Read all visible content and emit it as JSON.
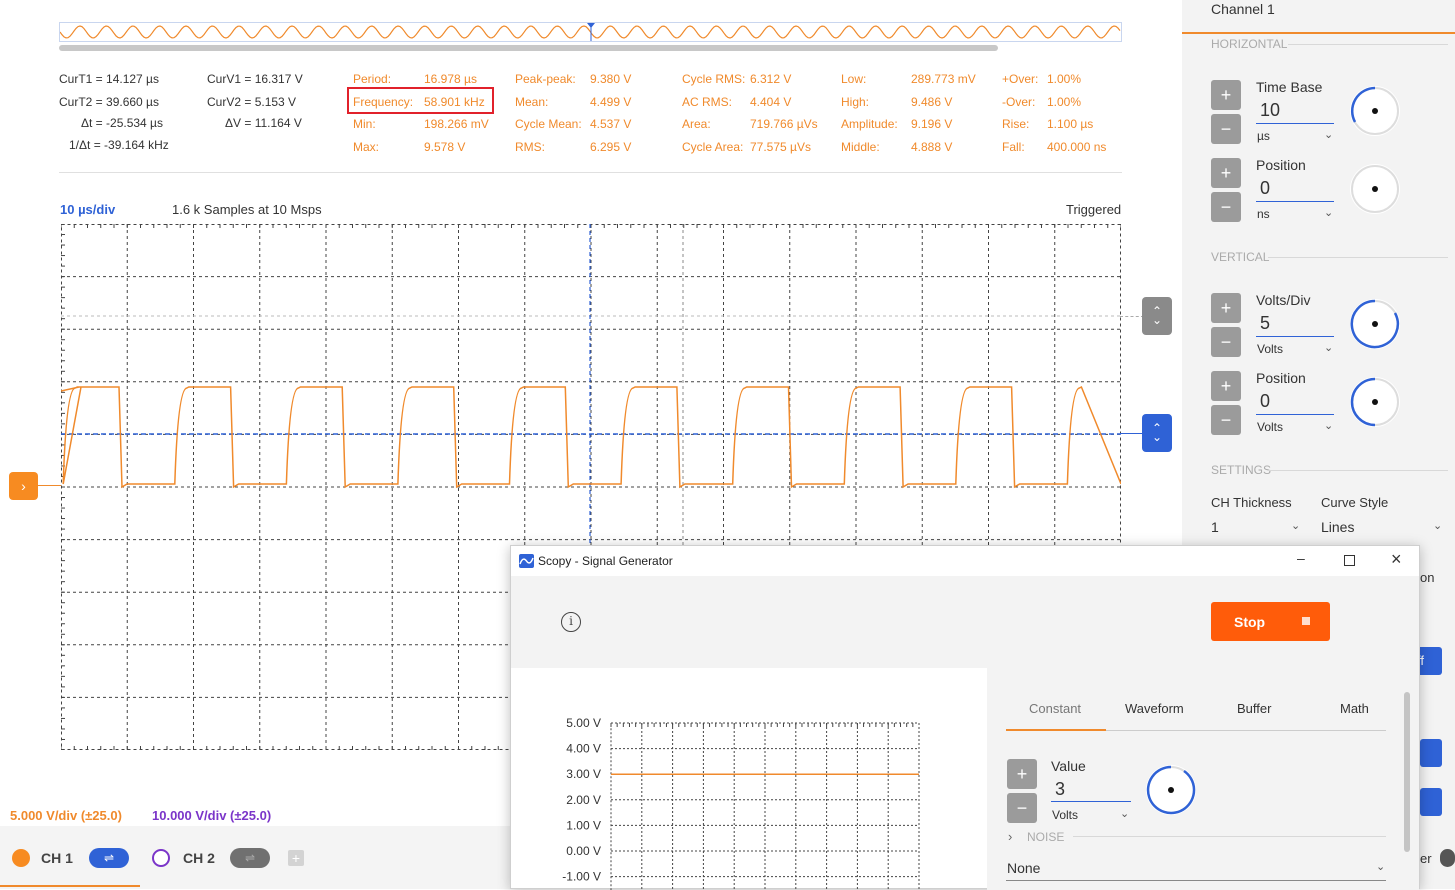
{
  "cursors": {
    "curT1": "CurT1 = 14.127 µs",
    "curT2": "CurT2 = 39.660 µs",
    "deltaT": "Δt = -25.534 µs",
    "invDeltaT": "1/Δt = -39.164 kHz",
    "curV1": "CurV1 = 16.317 V",
    "curV2": "CurV2 = 5.153 V",
    "deltaV": "ΔV = 11.164 V"
  },
  "measurements": [
    {
      "label": "Period:",
      "value": "16.978 µs"
    },
    {
      "label": "Frequency:",
      "value": "58.901 kHz"
    },
    {
      "label": "Min:",
      "value": "198.266 mV"
    },
    {
      "label": "Max:",
      "value": "9.578 V"
    },
    {
      "label": "Peak-peak:",
      "value": "9.380 V"
    },
    {
      "label": "Mean:",
      "value": "4.499 V"
    },
    {
      "label": "Cycle Mean:",
      "value": "4.537 V"
    },
    {
      "label": "RMS:",
      "value": "6.295 V"
    },
    {
      "label": "Cycle RMS:",
      "value": "6.312 V"
    },
    {
      "label": "AC RMS:",
      "value": "4.404 V"
    },
    {
      "label": "Area:",
      "value": "719.766 µVs"
    },
    {
      "label": "Cycle Area:",
      "value": "77.575 µVs"
    },
    {
      "label": "Low:",
      "value": "289.773 mV"
    },
    {
      "label": "High:",
      "value": "9.486 V"
    },
    {
      "label": "Amplitude:",
      "value": "9.196 V"
    },
    {
      "label": "Middle:",
      "value": "4.888 V"
    },
    {
      "label": "+Over:",
      "value": "1.00%"
    },
    {
      "label": "-Over:",
      "value": "1.00%"
    },
    {
      "label": "Rise:",
      "value": "1.100 µs"
    },
    {
      "label": "Fall:",
      "value": "400.000 ns"
    }
  ],
  "plot": {
    "time_div": "10 µs/div",
    "samples": "1.6 k Samples at 10 Msps",
    "status": "Triggered",
    "cycles_in_view": 9.5
  },
  "footer": {
    "ch1_vdiv": "5.000 V/div (±25.0)",
    "ch2_vdiv": "10.000 V/div (±25.0)",
    "ch1_label": "CH 1",
    "ch2_label": "CH 2"
  },
  "colors": {
    "ch1": "#f08a2c",
    "ch2": "#7b35c9",
    "accent": "#2f62d6",
    "highlight": "#e1212b"
  },
  "panel": {
    "title": "Channel 1",
    "horizontal": "HORIZONTAL",
    "vertical": "VERTICAL",
    "settings": "SETTINGS",
    "time_base": {
      "label": "Time Base",
      "value": "10",
      "unit": "µs"
    },
    "h_position": {
      "label": "Position",
      "value": "0",
      "unit": "ns"
    },
    "volts_div": {
      "label": "Volts/Div",
      "value": "5",
      "unit": "Volts"
    },
    "v_position": {
      "label": "Position",
      "value": "0",
      "unit": "Volts"
    },
    "ch_thickness": {
      "label": "CH Thickness",
      "value": "1"
    },
    "curve_style": {
      "label": "Curve Style",
      "value": "Lines"
    },
    "clipped_text_1": "on",
    "clipped_text_2": "ff",
    "clipped_text_3": "er"
  },
  "siggen": {
    "title": "Scopy - Signal Generator",
    "stop_label": "Stop",
    "y_ticks": [
      "5.00 V",
      "4.00 V",
      "3.00 V",
      "2.00 V",
      "1.00 V",
      "0.00 V",
      "-1.00 V"
    ],
    "preview_level": 3.0,
    "tabs": [
      "Constant",
      "Waveform",
      "Buffer",
      "Math"
    ],
    "active_tab": "Constant",
    "value": {
      "label": "Value",
      "value": "3",
      "unit": "Volts"
    },
    "noise_label": "NOISE",
    "noise_value": "None"
  }
}
